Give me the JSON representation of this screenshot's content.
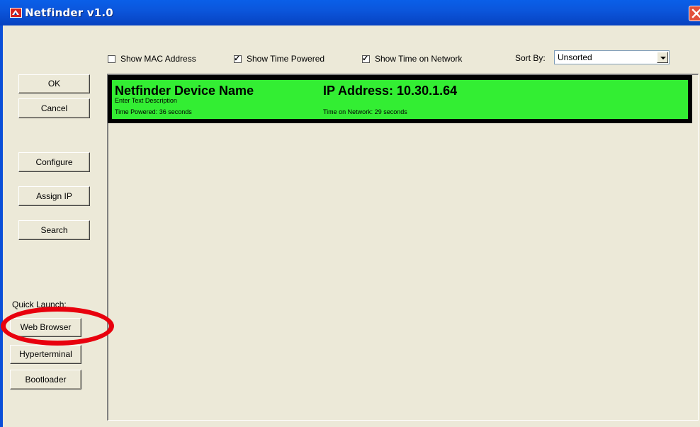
{
  "window": {
    "title": "Netfinder v1.0"
  },
  "options": {
    "show_mac": {
      "label": "Show MAC Address",
      "checked": false
    },
    "show_time_powered": {
      "label": "Show Time Powered",
      "checked": true
    },
    "show_time_network": {
      "label": "Show Time on Network",
      "checked": true
    },
    "sort_label": "Sort By:",
    "sort_value": "Unsorted"
  },
  "buttons": {
    "ok": "OK",
    "cancel": "Cancel",
    "configure": "Configure",
    "assign_ip": "Assign IP",
    "search": "Search",
    "quick_launch_label": "Quick Launch:",
    "web_browser": "Web Browser",
    "hyperterminal": "Hyperterminal",
    "bootloader": "Bootloader"
  },
  "device": {
    "name": "Netfinder Device Name",
    "description": "Enter Text Description",
    "ip": "IP Address: 10.30.1.64",
    "time_powered": "Time Powered:  36 seconds",
    "time_network": "Time on Network:  29 seconds",
    "color": "#33ee33"
  },
  "colors": {
    "titlebar": "#0a5fe8",
    "highlight": "#e8000d",
    "client": "#ece9d8"
  },
  "icons": [
    "app-icon",
    "close-icon",
    "check-icon",
    "dropdown-arrow-icon"
  ]
}
